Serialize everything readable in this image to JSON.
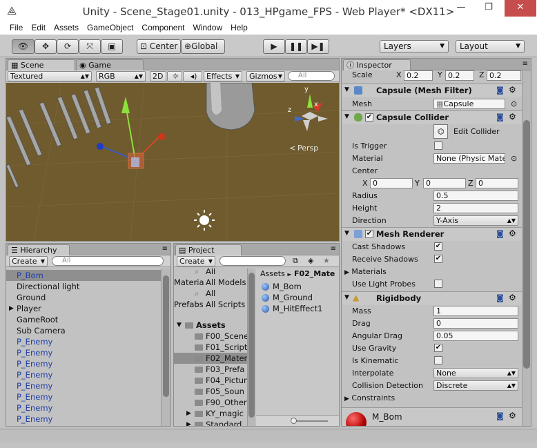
{
  "window": {
    "title": "Unity - Scene_Stage01.unity - 013_HPgame_FPS - Web Player* <DX11>",
    "minimize": "—",
    "maximize": "❐",
    "close": "✕"
  },
  "menu": [
    "File",
    "Edit",
    "Assets",
    "GameObject",
    "Component",
    "Window",
    "Help"
  ],
  "toolbar": {
    "center": "Center",
    "global": "Global",
    "layers": "Layers",
    "layout": "Layout"
  },
  "scene": {
    "tab_scene": "Scene",
    "tab_game": "Game",
    "shading": "Textured",
    "render_mode": "RGB",
    "mode_2d": "2D",
    "effects": "Effects",
    "gizmos": "Gizmos",
    "search_placeholder": "All",
    "persp": "Persp",
    "gizmo_x": "x",
    "gizmo_y": "y",
    "gizmo_z": "z"
  },
  "hierarchy": {
    "tab": "Hierarchy",
    "create": "Create",
    "search_placeholder": "All",
    "items": [
      "P_Bom",
      "Directional light",
      "Ground",
      "Player",
      "GameRoot",
      "Sub Camera",
      "P_Enemy",
      "P_Enemy",
      "P_Enemy",
      "P_Enemy",
      "P_Enemy",
      "P_Enemy",
      "P_Enemy",
      "P_Enemy"
    ]
  },
  "project": {
    "tab": "Project",
    "create": "Create",
    "breadcrumb_root": "Assets",
    "breadcrumb_sep": "►",
    "breadcrumb_current": "F02_Mate",
    "favorites": [
      "All Materia",
      "All Models",
      "All Prefabs",
      "All Scripts"
    ],
    "assets_label": "Assets",
    "folders": [
      "F00_Scene",
      "F01_Script",
      "F02_Mater",
      "F03_Prefa",
      "F04_Pictur",
      "F05_Soun",
      "F90_Other",
      "KY_magic",
      "Standard A"
    ],
    "files": [
      "M_Bom",
      "M_Ground",
      "M_HitEffect1"
    ]
  },
  "inspector": {
    "tab": "Inspector",
    "scale": {
      "label": "Scale",
      "x_label": "X",
      "x": "0.2",
      "y_label": "Y",
      "y": "0.2",
      "z_label": "Z",
      "z": "0.2"
    },
    "mesh_filter": {
      "title": "Capsule (Mesh Filter)",
      "mesh_label": "Mesh",
      "mesh_value": "Capsule"
    },
    "capsule_collider": {
      "title": "Capsule Collider",
      "edit_collider": "Edit Collider",
      "is_trigger": "Is Trigger",
      "material_label": "Material",
      "material_value": "None (Physic Mate",
      "center_label": "Center",
      "cx_label": "X",
      "cx": "0",
      "cy_label": "Y",
      "cy": "0",
      "cz_label": "Z",
      "cz": "0",
      "radius_label": "Radius",
      "radius": "0.5",
      "height_label": "Height",
      "height": "2",
      "direction_label": "Direction",
      "direction": "Y-Axis"
    },
    "mesh_renderer": {
      "title": "Mesh Renderer",
      "cast_shadows": "Cast Shadows",
      "receive_shadows": "Receive Shadows",
      "materials": "Materials",
      "use_light_probes": "Use Light Probes"
    },
    "rigidbody": {
      "title": "Rigidbody",
      "mass_label": "Mass",
      "mass": "1",
      "drag_label": "Drag",
      "drag": "0",
      "angular_drag_label": "Angular Drag",
      "angular_drag": "0.05",
      "use_gravity": "Use Gravity",
      "is_kinematic": "Is Kinematic",
      "interpolate_label": "Interpolate",
      "interpolate": "None",
      "collision_label": "Collision Detection",
      "collision": "Discrete",
      "constraints": "Constraints"
    },
    "material_preview": {
      "name": "M_Bom"
    }
  }
}
